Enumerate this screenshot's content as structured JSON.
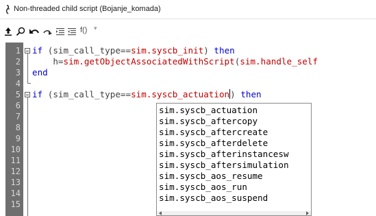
{
  "window": {
    "title": "Non-threaded child script (Bojanje_komada)",
    "icon": "script-icon"
  },
  "toolbar": {
    "icons": [
      "upload-icon",
      "search-icon",
      "undo-icon",
      "redo-icon",
      "indent-icon",
      "unindent-icon"
    ],
    "function_menu_label": "f()",
    "function_menu_caret": "▾"
  },
  "editor": {
    "line_numbers": [
      "1",
      "2",
      "3",
      "4",
      "5",
      "6",
      "7",
      "8",
      "9",
      "10",
      "11",
      "12",
      "13",
      "14",
      "15"
    ],
    "lines": {
      "l1": {
        "a": "if",
        "b": " (sim_call_type==",
        "c": "sim.syscb_init",
        "d": ") ",
        "e": "then"
      },
      "l2": {
        "a": "    h=",
        "b": "sim.getObjectAssociatedWithScript",
        "c": "(",
        "d": "sim.handle_self"
      },
      "l3": {
        "a": "end"
      },
      "l5": {
        "a": "if",
        "b": " (sim_call_type==",
        "c": "sim.syscb_actuation",
        "d": ") ",
        "e": "then"
      }
    },
    "colors": {
      "keyword": "#0000d0",
      "api": "#c00000",
      "plain": "#404040",
      "gutter": "#6f6f6f"
    }
  },
  "autocomplete": {
    "items": [
      "sim.syscb_actuation",
      "sim.syscb_aftercopy",
      "sim.syscb_aftercreate",
      "sim.syscb_afterdelete",
      "sim.syscb_afterinstancesw",
      "sim.syscb_aftersimulation",
      "sim.syscb_aos_resume",
      "sim.syscb_aos_run",
      "sim.syscb_aos_suspend"
    ]
  }
}
